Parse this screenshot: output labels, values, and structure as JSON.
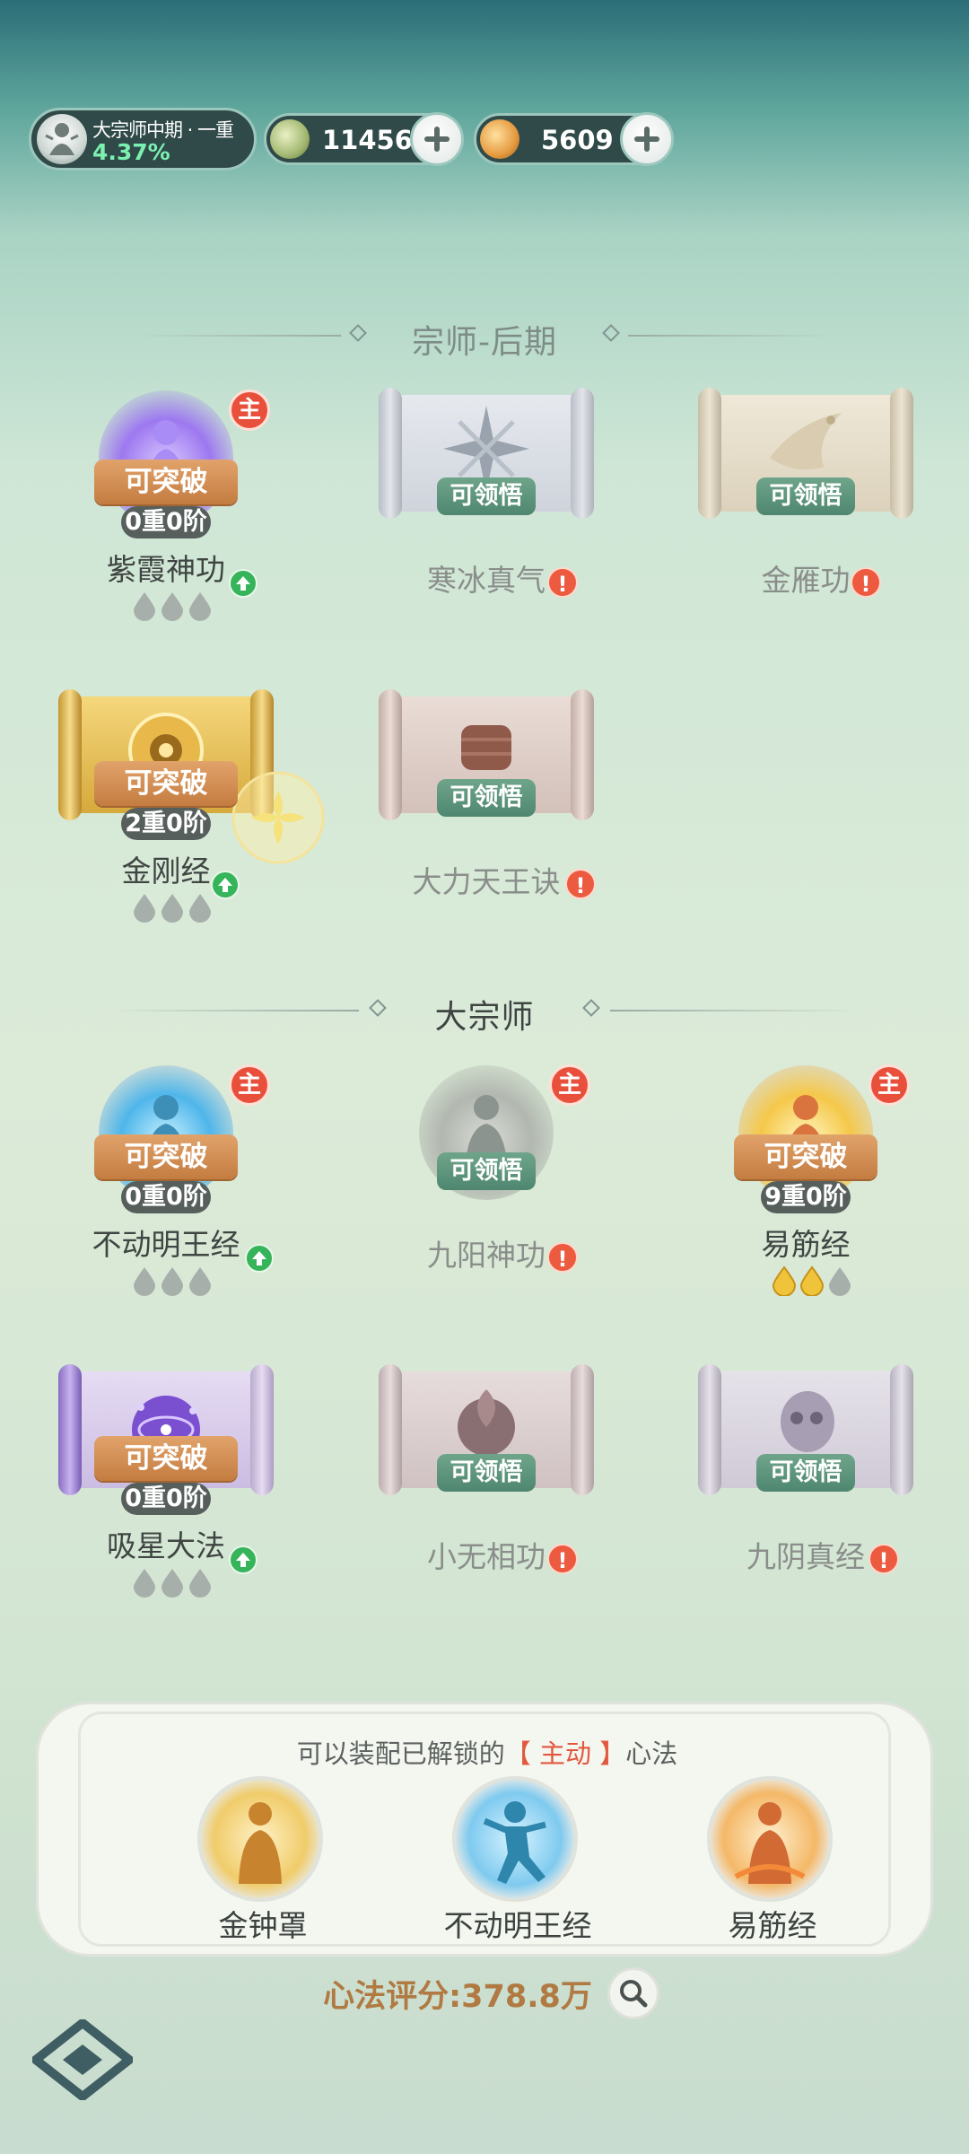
{
  "topbar": {
    "rank_name": "大宗师中期 · 一重",
    "rank_progress": "4.37%",
    "currency1_value": "11456",
    "currency2_value": "5609"
  },
  "sections": [
    {
      "title": "宗师-后期"
    },
    {
      "title": "大宗师"
    }
  ],
  "skills": [
    {
      "name": "紫霞神功",
      "status": "可突破",
      "level": "0重0阶",
      "main": "主",
      "drops_filled": 0
    },
    {
      "name": "寒冰真气",
      "status": "可领悟",
      "alert": "!"
    },
    {
      "name": "金雁功",
      "status": "可领悟",
      "alert": "!"
    },
    {
      "name": "金刚经",
      "status": "可突破",
      "level": "2重0阶",
      "drops_filled": 0
    },
    {
      "name": "大力天王诀",
      "status": "可领悟",
      "alert": "!"
    },
    {
      "name": "不动明王经",
      "status": "可突破",
      "level": "0重0阶",
      "main": "主",
      "drops_filled": 0
    },
    {
      "name": "九阳神功",
      "status": "可领悟",
      "main": "主",
      "alert": "!"
    },
    {
      "name": "易筋经",
      "status": "可突破",
      "level": "9重0阶",
      "main": "主",
      "drops_filled": 2
    },
    {
      "name": "吸星大法",
      "status": "可突破",
      "level": "0重0阶",
      "drops_filled": 0
    },
    {
      "name": "小无相功",
      "status": "可领悟",
      "alert": "!"
    },
    {
      "name": "九阴真经",
      "status": "可领悟",
      "alert": "!"
    }
  ],
  "equip_panel": {
    "hint_prefix": "可以装配已解锁的",
    "hint_highlight": "【 主动 】",
    "hint_suffix": "心法",
    "slots": [
      {
        "name": "金钟罩"
      },
      {
        "name": "不动明王经"
      },
      {
        "name": "易筋经"
      }
    ]
  },
  "score": {
    "label": "心法评分:378.8万"
  },
  "colors": {
    "accent_orange": "#c47c40",
    "alert_red": "#ec5a40",
    "level_up_green": "#36b45a",
    "score_gold": "#b07a42"
  }
}
